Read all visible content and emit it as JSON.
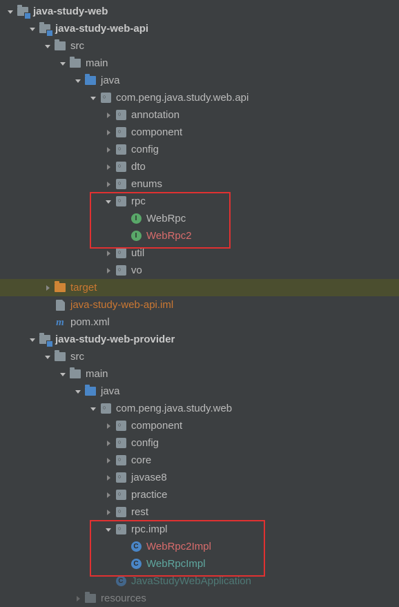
{
  "tree": {
    "root": "java-study-web",
    "module_api": "java-study-web-api",
    "src1": "src",
    "main1": "main",
    "java1": "java",
    "pkg_api": "com.peng.java.study.web.api",
    "annotation": "annotation",
    "component1": "component",
    "config1": "config",
    "dto": "dto",
    "enums": "enums",
    "rpc": "rpc",
    "WebRpc": "WebRpc",
    "WebRpc2": "WebRpc2",
    "util": "util",
    "vo": "vo",
    "target": "target",
    "iml": "java-study-web-api.iml",
    "pom": "pom.xml",
    "module_provider": "java-study-web-provider",
    "src2": "src",
    "main2": "main",
    "java2": "java",
    "pkg_web": "com.peng.java.study.web",
    "component2": "component",
    "config2": "config",
    "core": "core",
    "javase8": "javase8",
    "practice": "practice",
    "rest": "rest",
    "rpcimpl": "rpc.impl",
    "WebRpc2Impl": "WebRpc2Impl",
    "WebRpcImpl": "WebRpcImpl",
    "JavaStudyWebApplication": "JavaStudyWebApplication",
    "resources": "resources"
  }
}
